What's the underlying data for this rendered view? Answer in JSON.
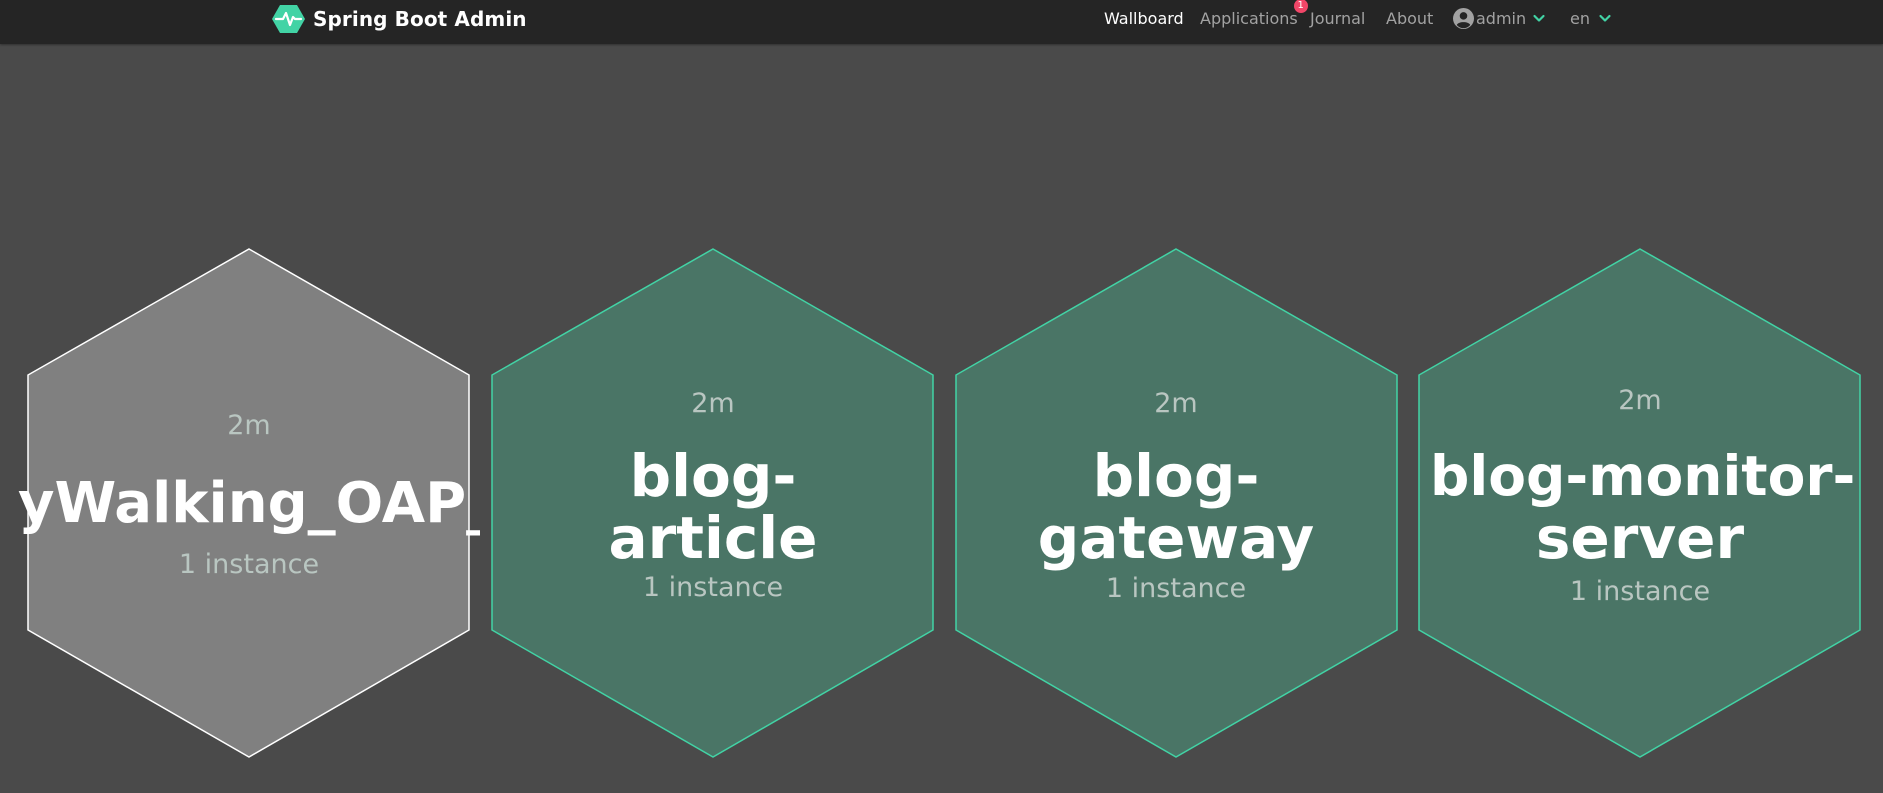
{
  "header": {
    "brand": "Spring Boot Admin",
    "nav": {
      "wallboard": "Wallboard",
      "applications": "Applications",
      "applications_badge": "1",
      "journal": "Journal",
      "about": "About",
      "user": "admin",
      "language": "en"
    },
    "icons": {
      "logo": "heartbeat-hexagon-icon",
      "user": "user-circle-icon",
      "chevron": "chevron-down-icon"
    }
  },
  "colors": {
    "background": "#4a4a4a",
    "navbar": "#252525",
    "accent": "#42d3a5",
    "hex_up_fill": "#4a7566",
    "hex_up_stroke": "#42d3a5",
    "hex_down_fill": "#808080",
    "hex_down_stroke": "#ffffff",
    "badge": "#f14668"
  },
  "applications": [
    {
      "name": "SkyWalking_OAP_Cluster",
      "visible_text": "yWalking_OAP_Clu",
      "time": "2m",
      "instances": "1 instance",
      "status": "down"
    },
    {
      "name_line1": "blog-",
      "name_line2": "article",
      "time": "2m",
      "instances": "1 instance",
      "status": "up"
    },
    {
      "name_line1": "blog-",
      "name_line2": "gateway",
      "time": "2m",
      "instances": "1 instance",
      "status": "up"
    },
    {
      "name_line1": "blog-monitor-",
      "name_line2": "server",
      "time": "2m",
      "instances": "1 instance",
      "status": "up"
    }
  ]
}
